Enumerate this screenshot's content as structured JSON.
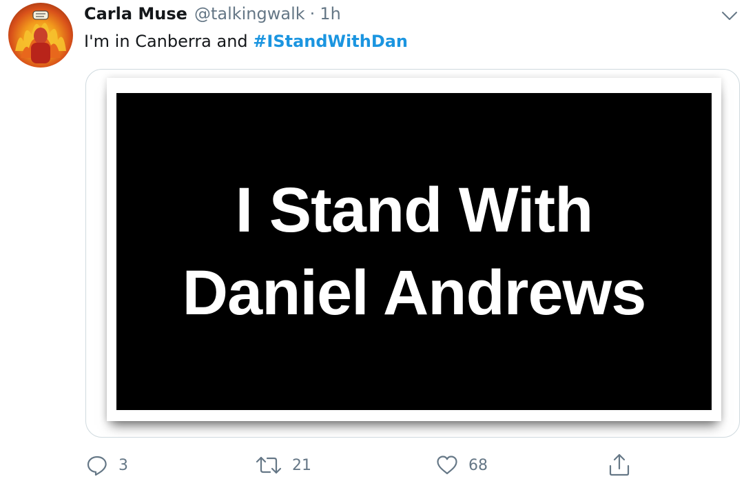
{
  "tweet": {
    "display_name": "Carla Muse",
    "handle": "@talkingwalk",
    "separator": "·",
    "time": "1h",
    "text_before": "I'm in Canberra and ",
    "hashtag": "#IStandWithDan",
    "more_icon": "chevron-down-icon",
    "avatar_icon": "avatar-image"
  },
  "media": {
    "line1": "I Stand With",
    "line2": "Daniel Andrews"
  },
  "actions": {
    "reply_count": "3",
    "retweet_count": "21",
    "like_count": "68",
    "reply_icon": "reply-icon",
    "retweet_icon": "retweet-icon",
    "like_icon": "heart-icon",
    "share_icon": "share-icon"
  },
  "colors": {
    "hashtag": "#1b95e0",
    "muted": "#657786",
    "text": "#14171a"
  }
}
